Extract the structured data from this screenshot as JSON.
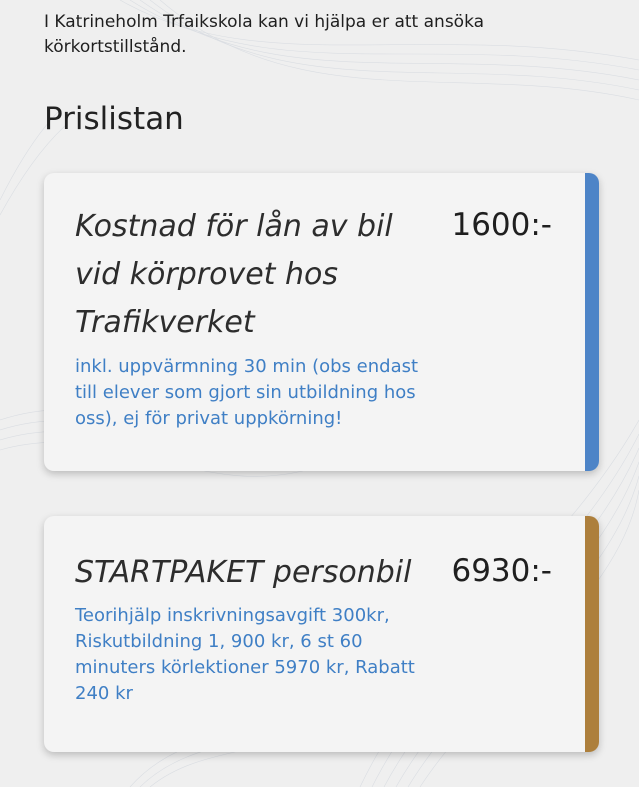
{
  "intro": {
    "text": "I Katrineholm Trfaikskola kan vi hjälpa er att ansöka körkortstillstånd."
  },
  "section": {
    "title": "Prislistan"
  },
  "price_cards": [
    {
      "title": "Kostnad för lån av bil vid körprovet hos Trafikverket",
      "price": "1600:-",
      "description": "inkl. uppvärmning 30 min (obs endast till elever som gjort sin utbildning hos oss), ej för privat uppkörning!",
      "accent_color": "#4d84c7"
    },
    {
      "title": "STARTPAKET personbil",
      "price": "6930:-",
      "description": "Teorihjälp inskrivningsavgift 300kr, Riskutbildning 1, 900 kr, 6 st 60 minuters körlektioner 5970 kr, Rabatt 240 kr",
      "accent_color": "#ad7f3c"
    }
  ],
  "colors": {
    "background": "#efefef",
    "card_background": "#f4f4f4",
    "description_text": "#3f7fc5"
  }
}
